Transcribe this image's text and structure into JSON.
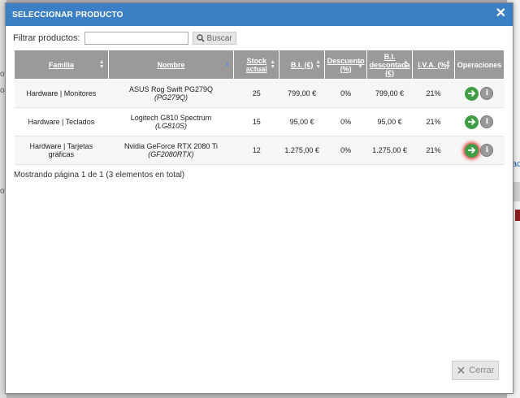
{
  "background": {
    "link_fragment": "ac",
    "left_text": [
      "o",
      "o",
      "o"
    ]
  },
  "dialog": {
    "title": "SELECCIONAR PRODUCTO",
    "close_glyph": "✕",
    "filter_label": "Filtrar productos:",
    "filter_value": "",
    "search_label": "Buscar",
    "columns": [
      {
        "label": "Familia",
        "sort": "both"
      },
      {
        "label": "Nombre",
        "sort": "asc"
      },
      {
        "label": "Stock actual",
        "sort": "both"
      },
      {
        "label": "B.I. (€)",
        "sort": "both"
      },
      {
        "label": "Descuento (%)",
        "sort": "both"
      },
      {
        "label": "B.I. descontada (€)",
        "sort": "both"
      },
      {
        "label": "I.V.A. (%)",
        "sort": "both"
      },
      {
        "label": "Operaciones",
        "sort": "none"
      }
    ],
    "rows": [
      {
        "familia": "Hardware | Monitores",
        "nombre": "ASUS Rog Swift PG279Q",
        "ref": "(PG279Q)",
        "stock": "25",
        "bi": "799,00 €",
        "descuento": "0%",
        "bi_desc": "799,00 €",
        "iva": "21%"
      },
      {
        "familia": "Hardware | Teclados",
        "nombre": "Logitech G810 Spectrum",
        "ref": "(LG810S)",
        "stock": "15",
        "bi": "95,00 €",
        "descuento": "0%",
        "bi_desc": "95,00 €",
        "iva": "21%"
      },
      {
        "familia": "Hardware | Tarjetas gráficas",
        "nombre": "Nvidia GeForce RTX 2080 Ti",
        "ref": "(GF2080RTX)",
        "stock": "12",
        "bi": "1.275,00 €",
        "descuento": "0%",
        "bi_desc": "1.275,00 €",
        "iva": "21%"
      }
    ],
    "pager_text": "Mostrando página 1 de 1 (3 elementos en total)",
    "close_button_label": "Cerrar",
    "colors": {
      "titlebar": "#3b7fc4",
      "header": "#9a9a9a",
      "go_button": "#3f9d45",
      "highlight": "#e23a3a"
    }
  }
}
